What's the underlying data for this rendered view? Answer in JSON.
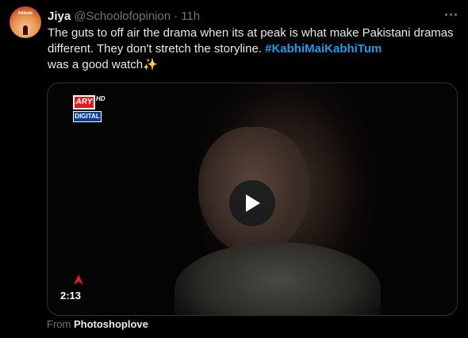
{
  "author": {
    "name": "Jiya",
    "handle": "@Schoolofopinion",
    "separator": "·",
    "time": "11h",
    "avatar_text": "Attitude"
  },
  "tweet": {
    "text_part1": "The guts to off air the drama when its at peak is what make Pakistani dramas different.  They don't stretch the storyline. ",
    "hashtag": "#KabhiMaiKabhiTum",
    "text_part2": " was a good watch",
    "emoji": "✨"
  },
  "media": {
    "channel_logo": "ARY",
    "channel_hd": "HD",
    "channel_sub": "DIGITAL",
    "duration": "2:13",
    "play_icon": "play-icon"
  },
  "source": {
    "prefix": "From",
    "name": "Photoshoplove"
  },
  "colors": {
    "background": "#000000",
    "text": "#e7e9ea",
    "secondary": "#71767b",
    "link": "#1d9bf0"
  }
}
